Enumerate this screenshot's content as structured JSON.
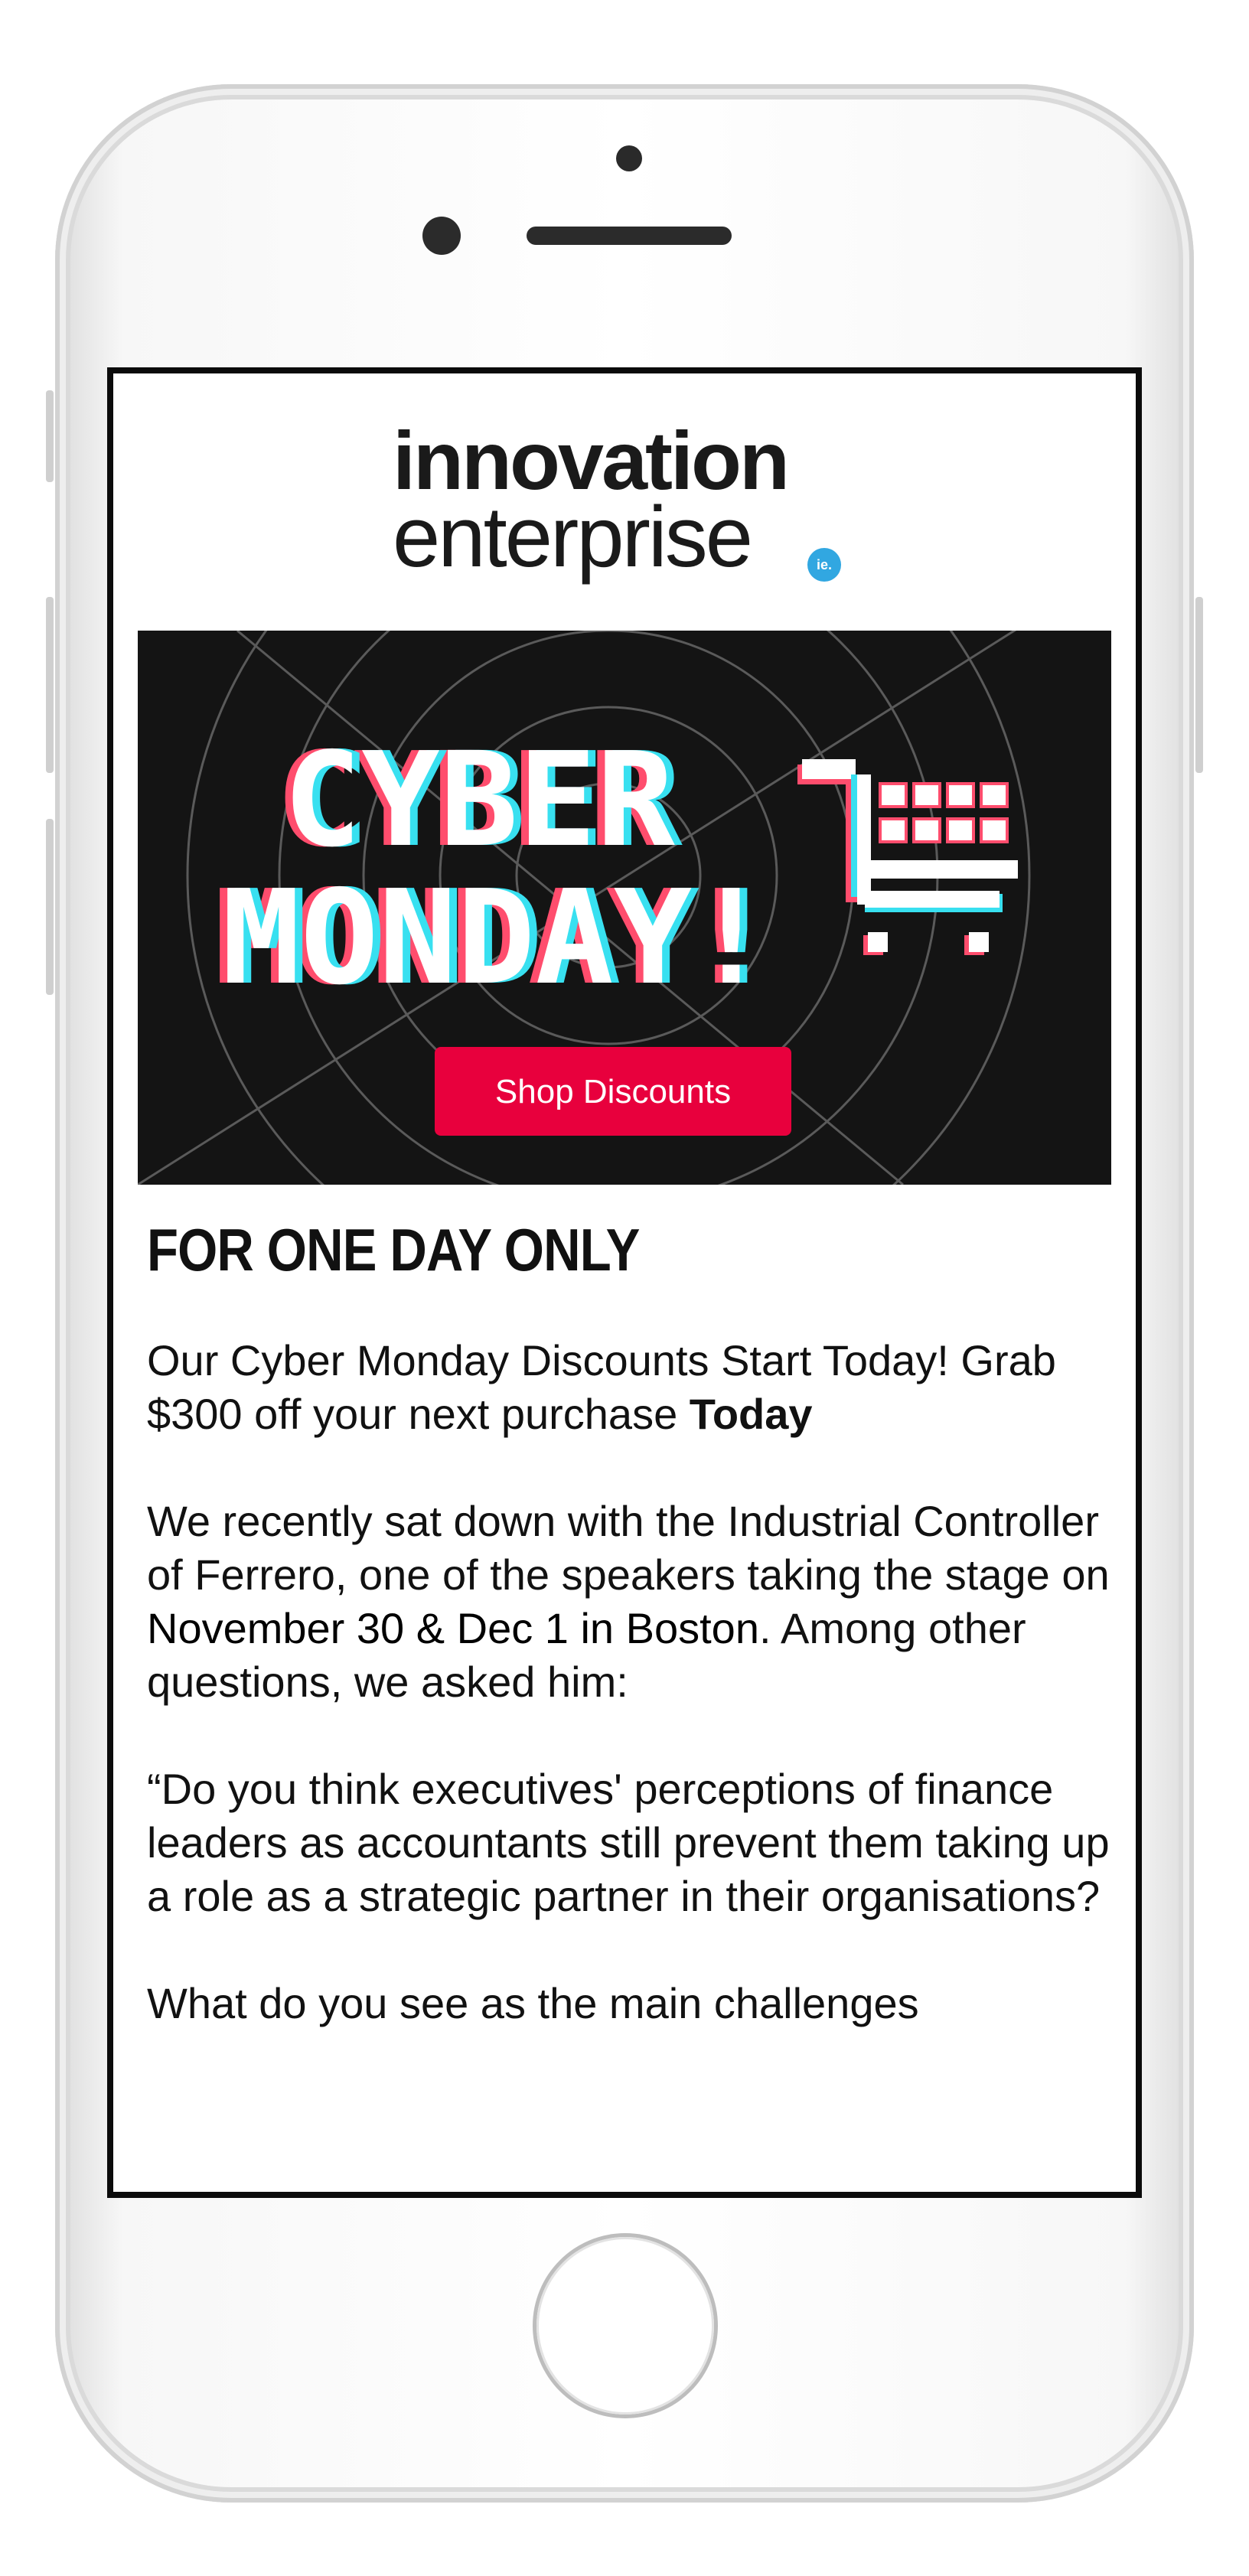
{
  "logo": {
    "line1": "innovation",
    "line2": "enterprise",
    "badge": "ie."
  },
  "banner": {
    "title_line1": "CYBER",
    "title_line2": "MONDAY!",
    "button_label": "Shop Discounts",
    "colors": {
      "background": "#141414",
      "button": "#e8003d",
      "glitch_red": "#ff4d6d",
      "glitch_cyan": "#38e0f0"
    }
  },
  "email": {
    "heading": "FOR ONE DAY ONLY",
    "p1_text": "Our Cyber Monday Discounts Start Today! Grab $300 off your next purchase ",
    "p1_bold": "Today",
    "p2_text_a": "We recently sat down with the Industrial Controller of Ferrero, one of the speakers taking the stage on ",
    "p2_bold": "November 30 & Dec 1 in Boston",
    "p2_text_b": ". Among other questions, we asked him:",
    "p3_text": "“Do you think executives' perceptions of finance leaders as accountants still prevent them taking up a role as a strategic partner in their organisations?",
    "p4_text": "What do you see as the main challenges"
  }
}
